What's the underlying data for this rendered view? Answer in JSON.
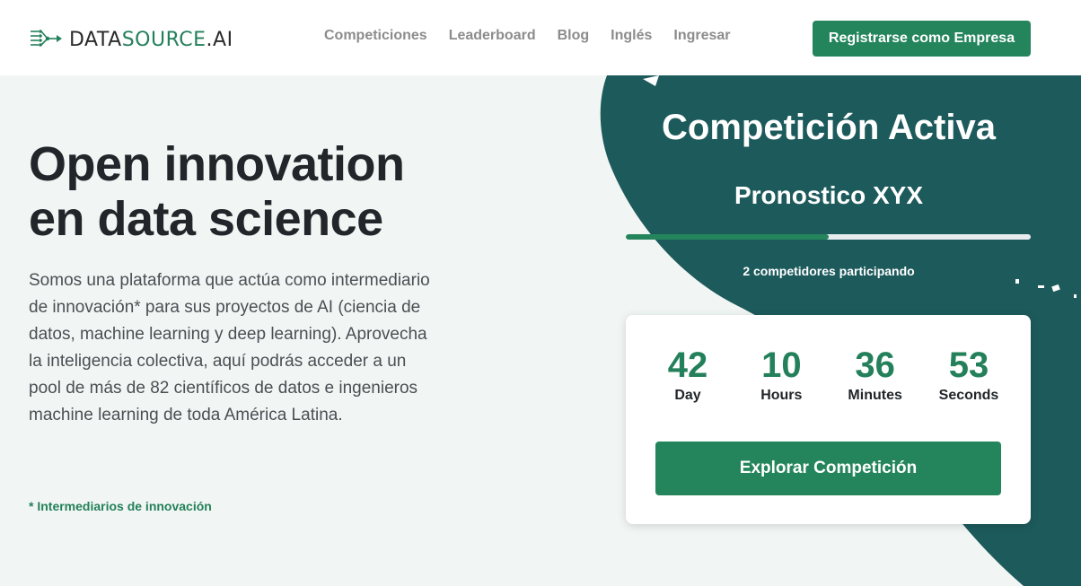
{
  "header": {
    "logo": {
      "prefix": "DATA",
      "highlight": "SOURCE",
      "suffix": ".AI"
    },
    "nav": [
      "Competiciones",
      "Leaderboard",
      "Blog",
      "Inglés",
      "Ingresar"
    ],
    "cta_label": "Registrarse como Empresa"
  },
  "hero": {
    "title_line1": "Open innovation",
    "title_line2": "en data science",
    "description": "Somos una plataforma que actúa como intermediario de innovación* para sus proyectos de AI (ciencia de datos, machine learning y deep learning). Aprovecha la inteligencia colectiva, aquí podrás acceder a un pool de más de 82 científicos de datos e ingenieros machine learning de toda América Latina.",
    "note": "* Intermediarios de innovación"
  },
  "competition": {
    "heading": "Competición Activa",
    "name": "Pronostico XYX",
    "progress_fraction": 0.5,
    "participants": "2 competidores participando",
    "countdown": [
      {
        "value": "42",
        "label": "Day"
      },
      {
        "value": "10",
        "label": "Hours"
      },
      {
        "value": "36",
        "label": "Minutes"
      },
      {
        "value": "53",
        "label": "Seconds"
      }
    ],
    "cta_label": "Explorar Competición"
  },
  "colors": {
    "accent_green": "#24855c",
    "dark_teal": "#1d5a5c",
    "background": "#f1f6f4"
  }
}
